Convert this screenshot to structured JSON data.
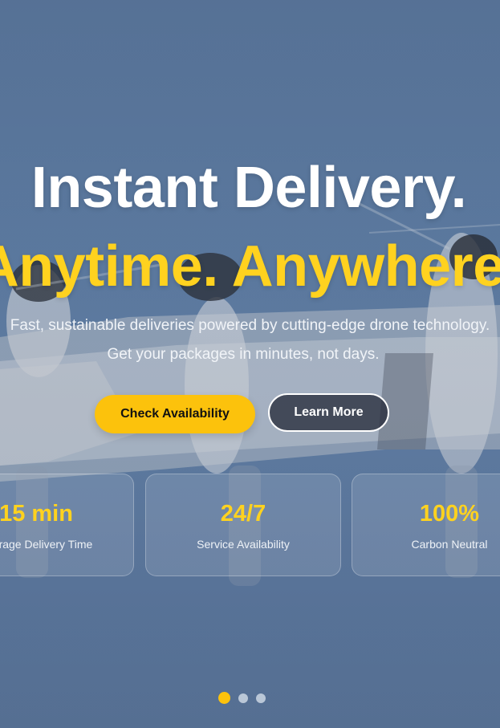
{
  "hero": {
    "headline_line1": "Instant Delivery.",
    "headline_line2": "Anytime. Anywhere.",
    "subtitle_line1": "Fast, sustainable deliveries powered by cutting-edge drone technology.",
    "subtitle_line2": "Get your packages in minutes, not days.",
    "primary_button": "Check Availability",
    "secondary_button": "Learn More",
    "background_icon": "drone-illustration"
  },
  "stats": [
    {
      "value": "15 min",
      "label": "Average Delivery Time"
    },
    {
      "value": "24/7",
      "label": "Service Availability"
    },
    {
      "value": "100%",
      "label": "Carbon Neutral"
    }
  ],
  "carousel": {
    "slides": 3,
    "active_index": 0
  },
  "colors": {
    "accent": "#fcc20c",
    "headline_accent": "#ffd21f",
    "background": "#5f7ea5"
  }
}
